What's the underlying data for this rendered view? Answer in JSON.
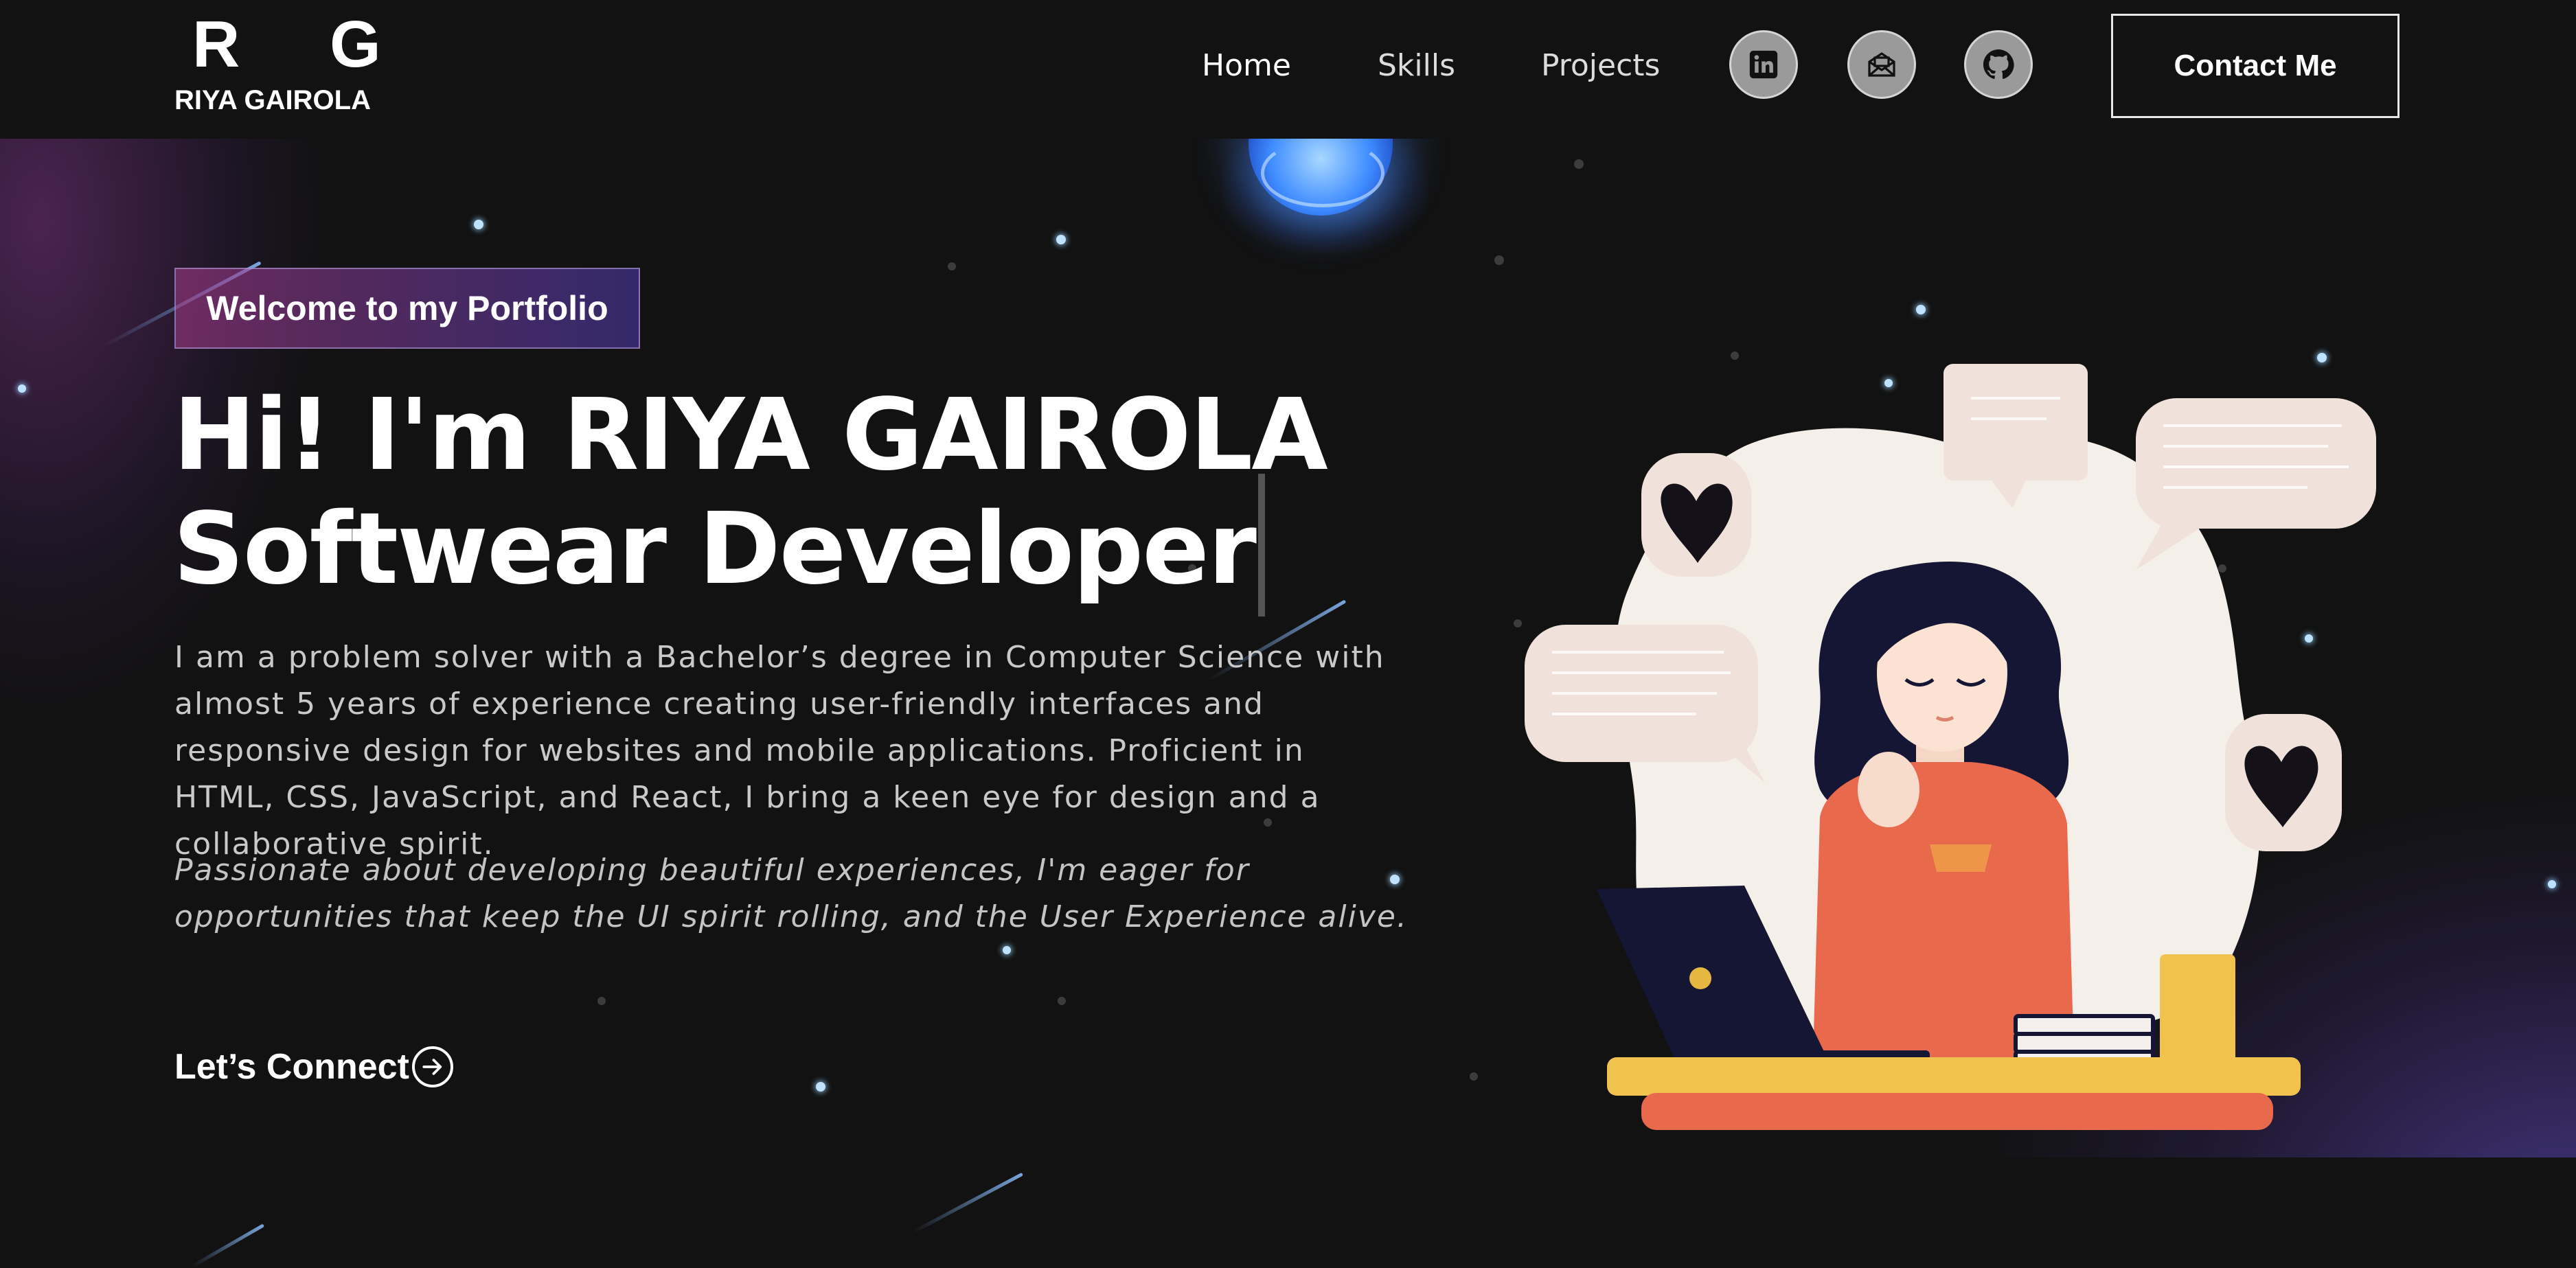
{
  "brand": {
    "mark": "R G",
    "name": "RIYA GAIROLA"
  },
  "nav": {
    "links": [
      {
        "label": "Home"
      },
      {
        "label": "Skills"
      },
      {
        "label": "Projects"
      }
    ],
    "social": [
      {
        "icon": "linkedin-icon"
      },
      {
        "icon": "mail-icon"
      },
      {
        "icon": "github-icon"
      }
    ],
    "contact_label": "Contact Me"
  },
  "hero": {
    "badge": "Welcome to my Portfolio",
    "headline_1": "Hi! I'm RIYA GAIROLA",
    "headline_2": "Softwear Developer",
    "intro": "I am a problem solver with a Bachelor’s degree in Computer Science with almost 5 years of experience creating user-friendly interfaces and responsive design for websites and mobile applications. Proficient in HTML, CSS, JavaScript, and React, I bring a keen eye for design and a collaborative spirit.",
    "tagline": "Passionate about developing beautiful experiences, I'm eager for opportunities that keep the UI spirit rolling, and the User Experience alive.",
    "cta_label": "Let’s Connect",
    "cta_icon": "arrow-right-circle-icon"
  },
  "colors": {
    "background": "#121212",
    "accent_purple": "#6a3cc8",
    "star": "#bfe3ff",
    "sweater": "#e8694c",
    "desk": "#f2c24e"
  }
}
